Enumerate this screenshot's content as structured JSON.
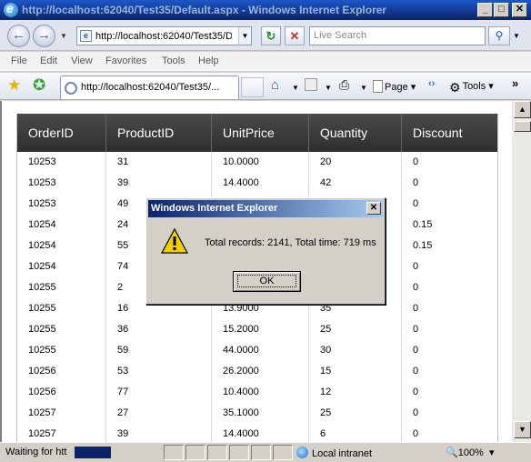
{
  "window": {
    "title": "http://localhost:62040/Test35/Default.aspx - Windows Internet Explorer",
    "minimize": "_",
    "maximize": "□",
    "close": "✕"
  },
  "address": {
    "url": "http://localhost:62040/Test35/Default.aspx",
    "search_placeholder": "Live Search"
  },
  "menu": [
    "File",
    "Edit",
    "View",
    "Favorites",
    "Tools",
    "Help"
  ],
  "tab": {
    "label": "http://localhost:62040/Test35/..."
  },
  "commands": {
    "page": "Page",
    "tools": "Tools"
  },
  "grid": {
    "columns": [
      "OrderID",
      "ProductID",
      "UnitPrice",
      "Quantity",
      "Discount"
    ],
    "rows": [
      [
        "10253",
        "31",
        "10.0000",
        "20",
        "0"
      ],
      [
        "10253",
        "39",
        "14.4000",
        "42",
        "0"
      ],
      [
        "10253",
        "49",
        "",
        "",
        "0"
      ],
      [
        "10254",
        "24",
        "",
        "",
        "0.15"
      ],
      [
        "10254",
        "55",
        "",
        "",
        "0.15"
      ],
      [
        "10254",
        "74",
        "",
        "",
        "0"
      ],
      [
        "10255",
        "2",
        "",
        "",
        "0"
      ],
      [
        "10255",
        "16",
        "13.9000",
        "35",
        "0"
      ],
      [
        "10255",
        "36",
        "15.2000",
        "25",
        "0"
      ],
      [
        "10255",
        "59",
        "44.0000",
        "30",
        "0"
      ],
      [
        "10256",
        "53",
        "26.2000",
        "15",
        "0"
      ],
      [
        "10256",
        "77",
        "10.4000",
        "12",
        "0"
      ],
      [
        "10257",
        "27",
        "35.1000",
        "25",
        "0"
      ],
      [
        "10257",
        "39",
        "14.4000",
        "6",
        "0"
      ]
    ]
  },
  "status": {
    "text": "Waiting for htt",
    "zone": "Local intranet",
    "zoom": "100%"
  },
  "dialog": {
    "title": "Windows Internet Explorer",
    "message": "Total records: 2141, Total time: 719 ms",
    "ok": "OK",
    "close": "✕"
  }
}
